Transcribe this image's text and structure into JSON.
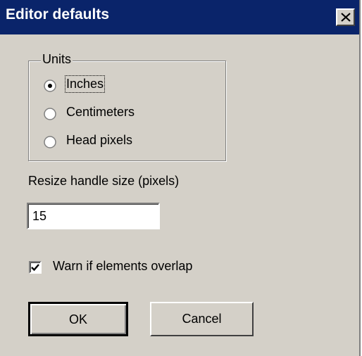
{
  "window": {
    "title": "Editor defaults",
    "close_icon": "close-icon"
  },
  "units": {
    "legend": "Units",
    "options": [
      {
        "label": "Inches",
        "selected": true
      },
      {
        "label": "Centimeters",
        "selected": false
      },
      {
        "label": "Head pixels",
        "selected": false
      }
    ]
  },
  "resize": {
    "label": "Resize handle size (pixels)",
    "value": "15"
  },
  "warn": {
    "label": "Warn if elements overlap",
    "checked": true
  },
  "buttons": {
    "ok": "OK",
    "cancel": "Cancel"
  }
}
